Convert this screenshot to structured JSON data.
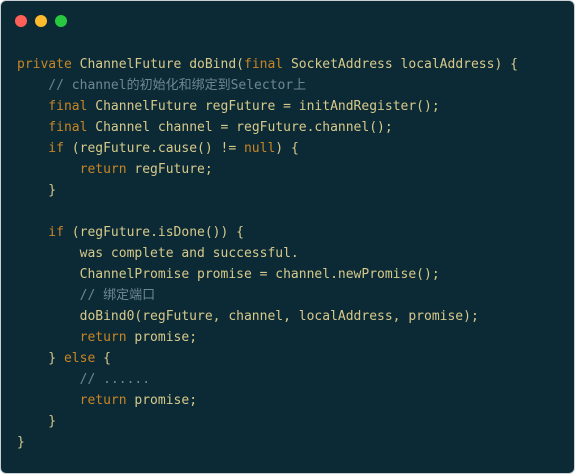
{
  "window_controls": [
    {
      "name": "close",
      "color": "#fe5f57"
    },
    {
      "name": "minimize",
      "color": "#febb2e"
    },
    {
      "name": "maximize",
      "color": "#28c840"
    }
  ],
  "code_lines": [
    [
      {
        "t": "private ",
        "k": "kw"
      },
      {
        "t": "ChannelFuture doBind(",
        "k": "id"
      },
      {
        "t": "final ",
        "k": "kw"
      },
      {
        "t": "SocketAddress localAddress) {",
        "k": "id"
      }
    ],
    [
      {
        "t": "    // channel的初始化和绑定到Selector上",
        "k": "cm"
      }
    ],
    [
      {
        "t": "    final ",
        "k": "kw"
      },
      {
        "t": "ChannelFuture regFuture = initAndRegister();",
        "k": "id"
      }
    ],
    [
      {
        "t": "    final ",
        "k": "kw"
      },
      {
        "t": "Channel channel = regFuture.channel();",
        "k": "id"
      }
    ],
    [
      {
        "t": "    if ",
        "k": "kw"
      },
      {
        "t": "(regFuture.cause() != ",
        "k": "id"
      },
      {
        "t": "null",
        "k": "kw"
      },
      {
        "t": ") {",
        "k": "id"
      }
    ],
    [
      {
        "t": "        return ",
        "k": "kw"
      },
      {
        "t": "regFuture;",
        "k": "id"
      }
    ],
    [
      {
        "t": "    }",
        "k": "id"
      }
    ],
    [
      {
        "t": "",
        "k": "id"
      }
    ],
    [
      {
        "t": "    if ",
        "k": "kw"
      },
      {
        "t": "(regFuture.isDone()) {",
        "k": "id"
      }
    ],
    [
      {
        "t": "        was complete and successful.",
        "k": "id"
      }
    ],
    [
      {
        "t": "        ChannelPromise promise = channel.newPromise();",
        "k": "id"
      }
    ],
    [
      {
        "t": "        // 绑定端口",
        "k": "cm"
      }
    ],
    [
      {
        "t": "        doBind0(regFuture, channel, localAddress, promise);",
        "k": "id"
      }
    ],
    [
      {
        "t": "        return ",
        "k": "kw"
      },
      {
        "t": "promise;",
        "k": "id"
      }
    ],
    [
      {
        "t": "    } ",
        "k": "id"
      },
      {
        "t": "else ",
        "k": "kw"
      },
      {
        "t": "{",
        "k": "id"
      }
    ],
    [
      {
        "t": "        // ......",
        "k": "cm"
      }
    ],
    [
      {
        "t": "        return ",
        "k": "kw"
      },
      {
        "t": "promise;",
        "k": "id"
      }
    ],
    [
      {
        "t": "    }",
        "k": "id"
      }
    ],
    [
      {
        "t": "}",
        "k": "id"
      }
    ]
  ]
}
